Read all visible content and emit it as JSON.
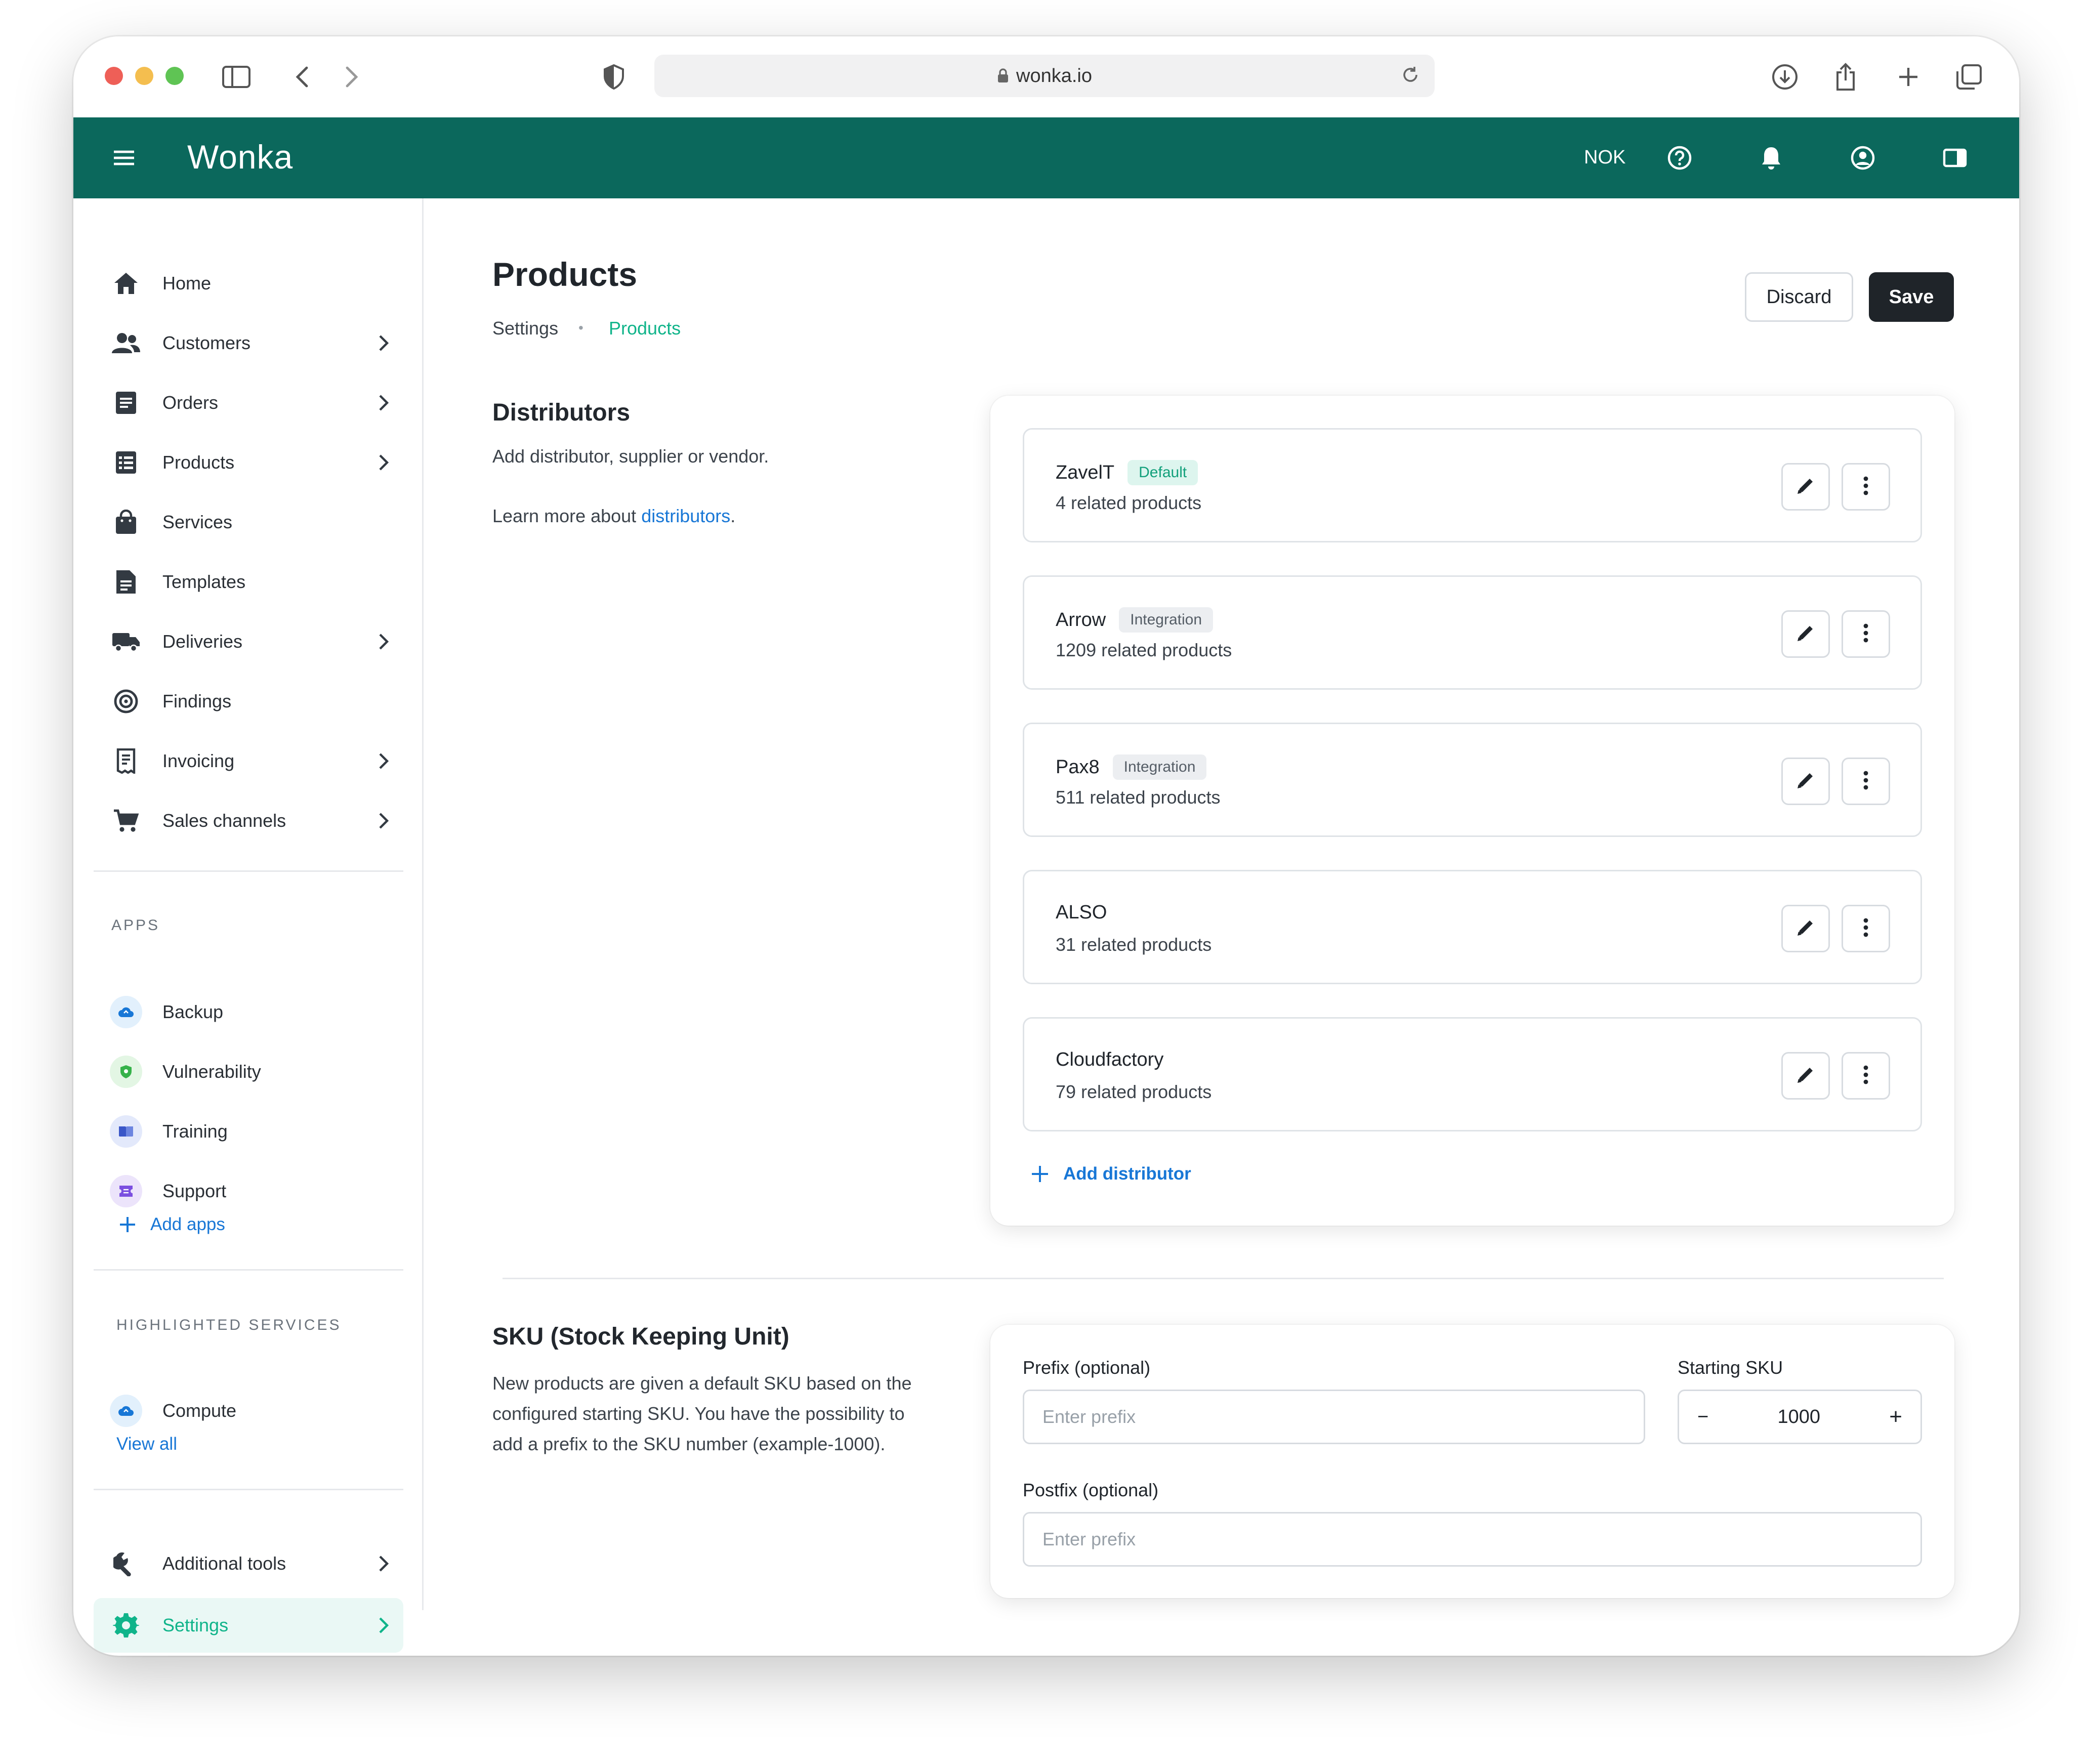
{
  "browser": {
    "url": "wonka.io"
  },
  "app": {
    "brand": "Wonka",
    "currency": "NOK"
  },
  "sidebar": {
    "items": [
      {
        "label": "Home"
      },
      {
        "label": "Customers"
      },
      {
        "label": "Orders"
      },
      {
        "label": "Products"
      },
      {
        "label": "Services"
      },
      {
        "label": "Templates"
      },
      {
        "label": "Deliveries"
      },
      {
        "label": "Findings"
      },
      {
        "label": "Invoicing"
      },
      {
        "label": "Sales channels"
      }
    ],
    "apps_title": "APPS",
    "apps": [
      {
        "label": "Backup"
      },
      {
        "label": "Vulnerability"
      },
      {
        "label": "Training"
      },
      {
        "label": "Support"
      }
    ],
    "add_apps": "Add apps",
    "highlighted_title": "HIGHLIGHTED SERVICES",
    "highlighted": [
      {
        "label": "Compute"
      }
    ],
    "view_all": "View all",
    "bottom": [
      {
        "label": "Additional tools"
      },
      {
        "label": "Settings"
      }
    ]
  },
  "page": {
    "title": "Products",
    "breadcrumb": [
      "Settings",
      "•",
      "Products"
    ],
    "discard": "Discard",
    "save": "Save"
  },
  "distributors": {
    "title": "Distributors",
    "description": "Add distributor, supplier or vendor.",
    "learn_prefix": "Learn more about",
    "learn_link": "distributors",
    "learn_suffix": ".",
    "list": [
      {
        "name": "ZavelT",
        "badge": "Default",
        "count": "4 related products"
      },
      {
        "name": "Arrow",
        "badge": "Integration",
        "count": "1209 related products"
      },
      {
        "name": "Pax8",
        "badge": "Integration",
        "count": "511 related products"
      },
      {
        "name": "ALSO",
        "badge": "",
        "count": "31 related products"
      },
      {
        "name": "Cloudfactory",
        "badge": "",
        "count": "79 related products"
      }
    ],
    "add_label": "Add distributor"
  },
  "sku": {
    "title": "SKU (Stock Keeping Unit)",
    "description_lines": [
      "New products are given a default SKU based on the",
      "configured starting SKU. You have the possibility to",
      "add a prefix to the SKU number (example-1000)."
    ],
    "prefix_label": "Prefix (optional)",
    "prefix_placeholder": "Enter prefix",
    "starting_label": "Starting SKU",
    "starting_value": "1000",
    "minus": "−",
    "plus": "+",
    "postfix_label": "Postfix (optional)",
    "postfix_placeholder": "Enter prefix"
  },
  "colors": {
    "header": "#0b685c",
    "accent": "#10b48a",
    "link": "#1877d6"
  }
}
